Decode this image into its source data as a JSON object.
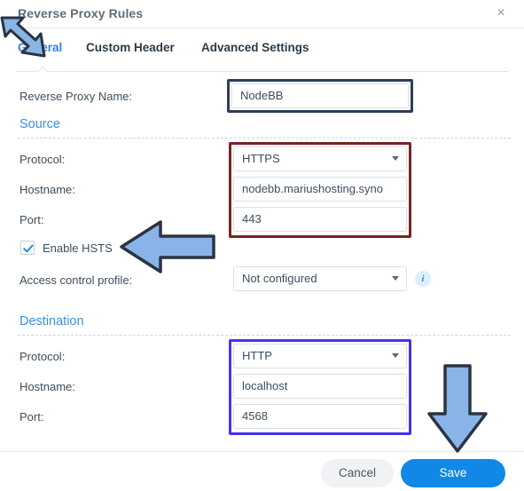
{
  "window": {
    "title": "Reverse Proxy Rules",
    "close_label": "×",
    "close_icon": "close-icon"
  },
  "tabs": [
    {
      "label": "General",
      "active": true
    },
    {
      "label": "Custom Header",
      "active": false
    },
    {
      "label": "Advanced Settings",
      "active": false
    }
  ],
  "general": {
    "name_label": "Reverse Proxy Name:",
    "name_value": "NodeBB"
  },
  "source": {
    "heading": "Source",
    "protocol_label": "Protocol:",
    "protocol_value": "HTTPS",
    "hostname_label": "Hostname:",
    "hostname_value": "nodebb.mariushosting.syno",
    "port_label": "Port:",
    "port_value": "443",
    "hsts_label": "Enable HSTS",
    "hsts_checked": true,
    "acl_label": "Access control profile:",
    "acl_value": "Not configured",
    "info_icon": "info-icon",
    "info_glyph": "i"
  },
  "destination": {
    "heading": "Destination",
    "protocol_label": "Protocol:",
    "protocol_value": "HTTP",
    "hostname_label": "Hostname:",
    "hostname_value": "localhost",
    "port_label": "Port:",
    "port_value": "4568"
  },
  "footer": {
    "cancel_label": "Cancel",
    "save_label": "Save"
  },
  "annotations": {
    "arrow_fill": "#8ab4e8",
    "arrow_stroke": "#2b3342",
    "arrow_general": "arrow-pointing-to-general-tab",
    "arrow_hsts": "arrow-pointing-to-enable-hsts",
    "arrow_save": "arrow-pointing-to-save-button"
  },
  "colors": {
    "accent_blue": "#2f7fe8",
    "save_blue": "#1288e6",
    "highlight_navy": "#2c3e5a",
    "highlight_maroon": "#7a2222",
    "highlight_blue": "#4433ee",
    "section_heading": "#3a8fe0"
  }
}
